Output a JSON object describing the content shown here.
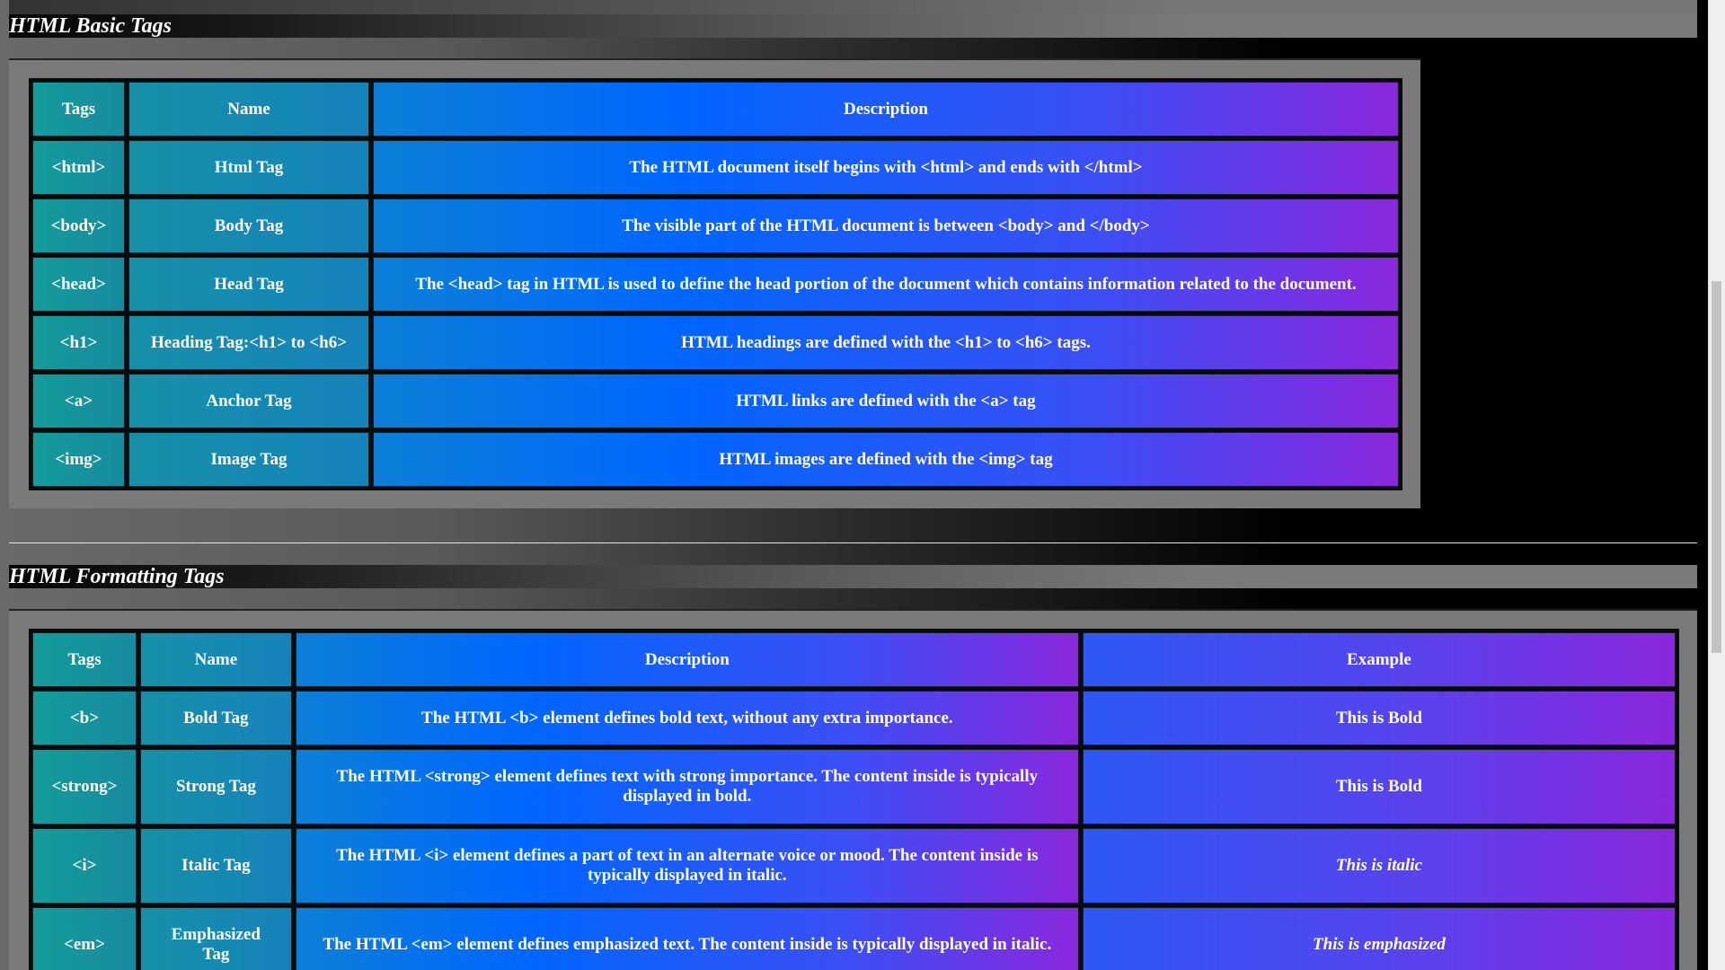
{
  "sections": {
    "basic": {
      "title": "HTML Basic Tags",
      "headers": {
        "tags": "Tags",
        "name": "Name",
        "description": "Description"
      },
      "rows": [
        {
          "tag": "<html>",
          "name": "Html Tag",
          "description": "The HTML document itself begins with <html> and ends with </html>"
        },
        {
          "tag": "<body>",
          "name": "Body Tag",
          "description": "The visible part of the HTML document is between <body> and </body>"
        },
        {
          "tag": "<head>",
          "name": "Head Tag",
          "description": "The <head> tag in HTML is used to define the head portion of the document which contains information related to the document."
        },
        {
          "tag": "<h1>",
          "name": "Heading Tag:<h1> to <h6>",
          "description": "HTML headings are defined with the <h1> to <h6> tags."
        },
        {
          "tag": "<a>",
          "name": "Anchor Tag",
          "description": "HTML links are defined with the <a> tag"
        },
        {
          "tag": "<img>",
          "name": "Image Tag",
          "description": "HTML images are defined with the <img> tag"
        }
      ]
    },
    "formatting": {
      "title": "HTML Formatting Tags",
      "headers": {
        "tags": "Tags",
        "name": "Name",
        "description": "Description",
        "example": "Example"
      },
      "rows": [
        {
          "tag": "<b>",
          "name": "Bold Tag",
          "description": "The HTML <b> element defines bold text, without any extra importance.",
          "example": "This is Bold"
        },
        {
          "tag": "<strong>",
          "name": "Strong Tag",
          "description": "The HTML <strong> element defines text with strong importance. The content inside is typically displayed in bold.",
          "example": "This is Bold"
        },
        {
          "tag": "<i>",
          "name": "Italic Tag",
          "description": "The HTML <i> element defines a part of text in an alternate voice or mood. The content inside is typically displayed in italic.",
          "example": "This is italic"
        },
        {
          "tag": "<em>",
          "name": "Emphasized Tag",
          "description": "The HTML <em> element defines emphasized text. The content inside is typically displayed in italic.",
          "example": "This is emphasized"
        }
      ]
    }
  },
  "colors": {
    "tag_cell": "#139c9a",
    "description_start": "#0066ff",
    "description_end": "#8a27dd",
    "table_frame": "#7a7a7a"
  }
}
